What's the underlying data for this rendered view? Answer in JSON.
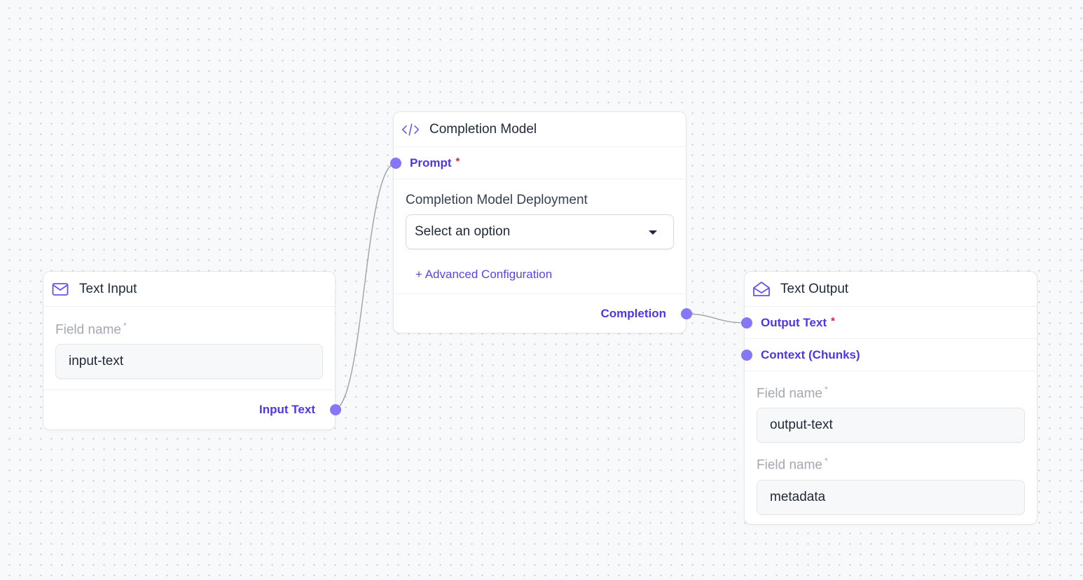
{
  "nodes": {
    "text_input": {
      "title": "Text Input",
      "icon": "mail-icon",
      "field_label": "Field name",
      "field_required": "*",
      "field_value": "input-text",
      "output_port": "Input Text"
    },
    "completion_model": {
      "title": "Completion Model",
      "icon": "code-icon",
      "input_port": "Prompt",
      "input_required": "*",
      "deployment_label": "Completion Model Deployment",
      "select_placeholder": "Select an option",
      "advanced_link": "+ Advanced Configuration",
      "output_port": "Completion"
    },
    "text_output": {
      "title": "Text Output",
      "icon": "mail-open-icon",
      "port_output_text": "Output Text",
      "port_output_required": "*",
      "port_context": "Context (Chunks)",
      "field1_label": "Field name",
      "field1_required": "*",
      "field1_value": "output-text",
      "field2_label": "Field name",
      "field2_required": "*",
      "field2_value": "metadata"
    }
  },
  "colors": {
    "accent": "#4f35e8",
    "handle": "#8577f5",
    "required": "#e11d48",
    "edge": "#a3a6ad"
  }
}
